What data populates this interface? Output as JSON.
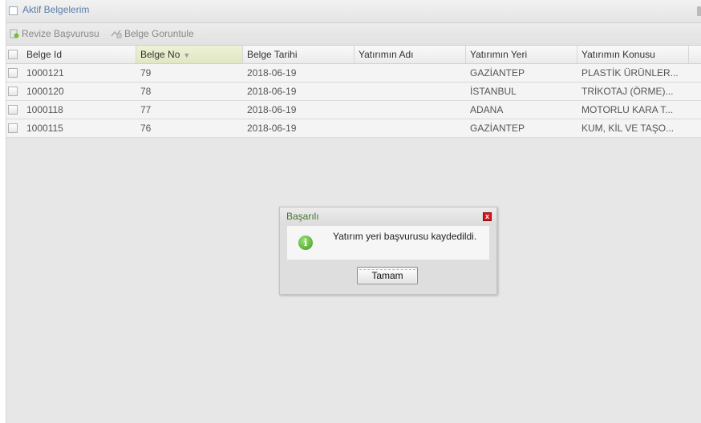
{
  "panel": {
    "title": "Aktif Belgelerim"
  },
  "toolbar": {
    "revize_label": "Revize Başvurusu",
    "goruntule_label": "Belge Goruntule"
  },
  "grid": {
    "columns": [
      "Belge Id",
      "Belge No",
      "Belge Tarihi",
      "Yatırımın Adı",
      "Yatırımın Yeri",
      "Yatırımın Konusu"
    ],
    "sorted_column": "Belge No",
    "rows": [
      [
        "1000121",
        "79",
        "2018-06-19",
        "",
        "GAZİANTEP",
        "PLASTİK ÜRÜNLER..."
      ],
      [
        "1000120",
        "78",
        "2018-06-19",
        "",
        "İSTANBUL",
        "TRİKOTAJ (ÖRME)..."
      ],
      [
        "1000118",
        "77",
        "2018-06-19",
        "",
        "ADANA",
        "MOTORLU KARA T..."
      ],
      [
        "1000115",
        "76",
        "2018-06-19",
        "",
        "GAZİANTEP",
        "KUM, KİL VE TAŞO..."
      ]
    ]
  },
  "dialog": {
    "title": "Başarılı",
    "message": "Yatırım yeri başvurusu kaydedildi.",
    "ok_label": "Tamam",
    "info_glyph": "i",
    "close_glyph": "x"
  },
  "icons": {
    "revize": "add-document-icon",
    "goruntule": "view-document-icon",
    "sort": "sort-desc-icon",
    "info": "info-icon",
    "close": "close-icon"
  },
  "colors": {
    "title_blue": "#5a7ea8",
    "dialog_title_green": "#45752d",
    "sorted_header": "#e4e8c8"
  }
}
